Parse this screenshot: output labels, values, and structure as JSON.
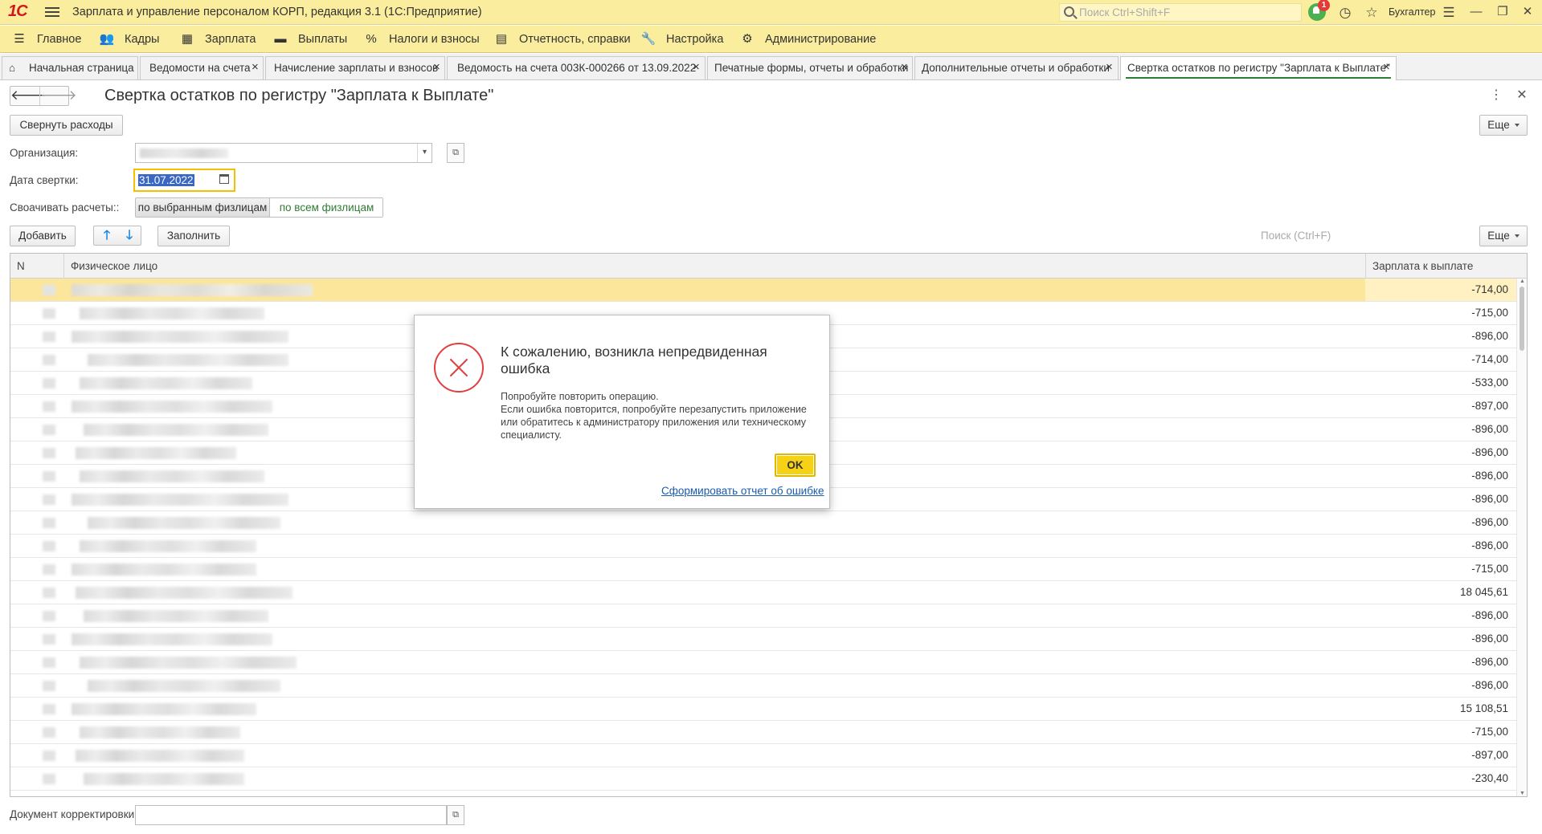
{
  "app": {
    "logo": "1С",
    "title": "Зарплата и управление персоналом КОРП, редакция 3.1  (1С:Предприятие)",
    "search_placeholder": "Поиск Ctrl+Shift+F",
    "notifications_count": "1",
    "user": "Бухгалтер",
    "win_minimize": "—",
    "win_restore": "❐",
    "win_close": "✕"
  },
  "menu": [
    {
      "label": "Главное",
      "icon": "hamburger-icon"
    },
    {
      "label": "Кадры",
      "icon": "people-icon"
    },
    {
      "label": "Зарплата",
      "icon": "calculator-icon"
    },
    {
      "label": "Выплаты",
      "icon": "wallet-icon"
    },
    {
      "label": "Налоги и взносы",
      "icon": "percent-icon"
    },
    {
      "label": "Отчетность, справки",
      "icon": "document-icon"
    },
    {
      "label": "Настройка",
      "icon": "wrench-icon"
    },
    {
      "label": "Администрирование",
      "icon": "gear-icon"
    }
  ],
  "tabs": [
    {
      "label": "Начальная страница",
      "home": true
    },
    {
      "label": "Ведомости на счета"
    },
    {
      "label": "Начисление зарплаты и взносов"
    },
    {
      "label": "Ведомость на счета 003К-000266 от 13.09.2022"
    },
    {
      "label": "Печатные формы, отчеты и обработки"
    },
    {
      "label": "Дополнительные отчеты и обработки"
    },
    {
      "label": "Свертка остатков по регистру \"Зарплата к Выплате\"",
      "active": true
    }
  ],
  "form": {
    "title": "Свертка остатков по регистру \"Зарплата к Выплате\"",
    "collapse_button": "Свернуть расходы",
    "more_button": "Еще",
    "org_label": "Организация:",
    "date_label": "Дата свертки:",
    "date_value": "31.07.2022",
    "settle_label": "Своачивать расчеты::",
    "settle_option_selected": "по выбранным физлицам",
    "settle_option_all": "по всем физлицам",
    "add_button": "Добавить",
    "fill_button": "Заполнить",
    "search_placeholder": "Поиск (Ctrl+F)",
    "more_button2": "Еще",
    "doc_label": "Документ корректировки:"
  },
  "table": {
    "columns": [
      "N",
      "Физическое лицо",
      "Зарплата к выплате"
    ],
    "rows": [
      {
        "sum": "-714,00"
      },
      {
        "sum": "-715,00"
      },
      {
        "sum": "-896,00"
      },
      {
        "sum": "-714,00"
      },
      {
        "sum": "-533,00"
      },
      {
        "sum": "-897,00"
      },
      {
        "sum": "-896,00"
      },
      {
        "sum": "-896,00"
      },
      {
        "sum": "-896,00"
      },
      {
        "sum": "-896,00"
      },
      {
        "sum": "-896,00"
      },
      {
        "sum": "-896,00"
      },
      {
        "sum": "-715,00"
      },
      {
        "sum": "18 045,61"
      },
      {
        "sum": "-896,00"
      },
      {
        "sum": "-896,00"
      },
      {
        "sum": "-896,00"
      },
      {
        "sum": "-896,00"
      },
      {
        "sum": "15 108,51"
      },
      {
        "sum": "-715,00"
      },
      {
        "sum": "-897,00"
      },
      {
        "sum": "-230,40"
      }
    ]
  },
  "dialog": {
    "title": "К сожалению, возникла непредвиденная ошибка",
    "message": "Попробуйте повторить операцию.\nЕсли ошибка повторится, попробуйте перезапустить приложение или обратитесь к администратору приложения или техническому специалисту.",
    "ok_button": "OK",
    "report_link": "Сформировать отчет об ошибке"
  },
  "colors": {
    "header_bg": "#fbed9e",
    "selected_row": "#fce69b",
    "accent_green": "#2e7d32",
    "ok_button": "#f5d216",
    "error_red": "#e04040",
    "link": "#1a5aab"
  }
}
